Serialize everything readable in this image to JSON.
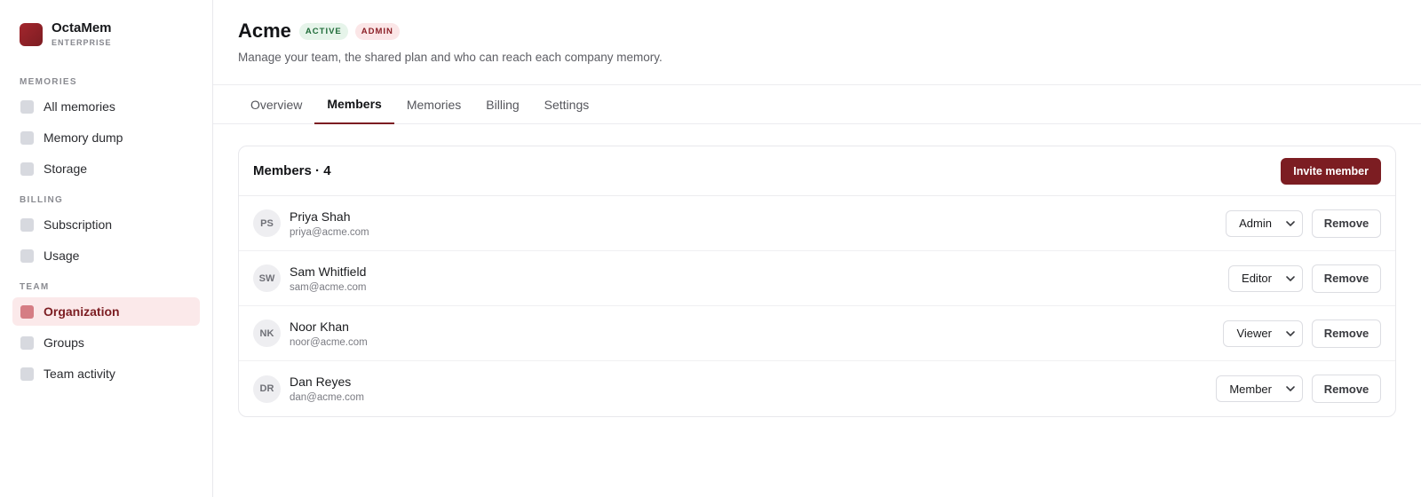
{
  "brand": {
    "name": "OctaMem",
    "plan": "ENTERPRISE"
  },
  "sidebar": {
    "sections": [
      {
        "title": "MEMORIES",
        "items": [
          {
            "label": "All memories",
            "active": false
          },
          {
            "label": "Memory dump",
            "active": false
          },
          {
            "label": "Storage",
            "active": false
          }
        ]
      },
      {
        "title": "BILLING",
        "items": [
          {
            "label": "Subscription",
            "active": false
          },
          {
            "label": "Usage",
            "active": false
          }
        ]
      },
      {
        "title": "TEAM",
        "items": [
          {
            "label": "Organization",
            "active": true
          },
          {
            "label": "Groups",
            "active": false
          },
          {
            "label": "Team activity",
            "active": false
          }
        ]
      }
    ]
  },
  "header": {
    "title": "Acme",
    "badges": {
      "status": "ACTIVE",
      "role": "ADMIN"
    },
    "subtitle": "Manage your team, the shared plan and who can reach each company memory."
  },
  "tabs": [
    {
      "label": "Overview",
      "active": false
    },
    {
      "label": "Members",
      "active": true
    },
    {
      "label": "Memories",
      "active": false
    },
    {
      "label": "Billing",
      "active": false
    },
    {
      "label": "Settings",
      "active": false
    }
  ],
  "members_card": {
    "title": "Members · 4",
    "invite_label": "Invite member",
    "remove_label": "Remove",
    "members": [
      {
        "initials": "PS",
        "name": "Priya Shah",
        "email": "priya@acme.com",
        "role": "Admin"
      },
      {
        "initials": "SW",
        "name": "Sam Whitfield",
        "email": "sam@acme.com",
        "role": "Editor"
      },
      {
        "initials": "NK",
        "name": "Noor Khan",
        "email": "noor@acme.com",
        "role": "Viewer"
      },
      {
        "initials": "DR",
        "name": "Dan Reyes",
        "email": "dan@acme.com",
        "role": "Member"
      }
    ]
  },
  "colors": {
    "accent": "#7c1d22",
    "active_bg": "#fbe9ea",
    "status_green": "#1e6b38"
  },
  "icons": {
    "nav": "square-icon",
    "select": "chevron-down-icon"
  }
}
